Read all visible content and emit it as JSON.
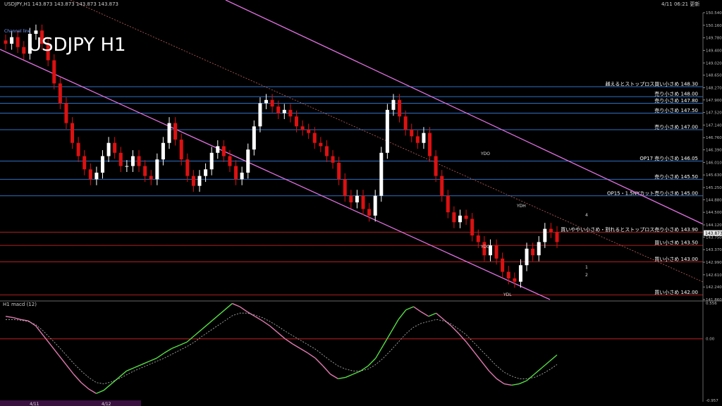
{
  "header": {
    "symbol_info": "USDJPY,H1  143.873 143.873 143.873 143.873",
    "datetime": "4/11 06:21 更新",
    "big_title": "USDJPY H1",
    "indicator_label": "Channel line",
    "sub_title": "H1  macd (12)"
  },
  "colors": {
    "background": "#000000",
    "bull": "#ffffff",
    "bear": "#dd1111",
    "channel": "#e070e0",
    "level_line": "#2f6fc0",
    "macd_up": "#55dd44",
    "macd_down": "#e07ab0",
    "price_marker": "#e8e8e8"
  },
  "chart_data": {
    "type": "candlestick",
    "symbol": "USDJPY",
    "timeframe": "H1",
    "ylim": [
      141.86,
      150.54
    ],
    "price_ticks": [
      "150.540",
      "150.160",
      "149.780",
      "149.400",
      "149.020",
      "148.650",
      "148.270",
      "147.900",
      "147.520",
      "147.140",
      "146.760",
      "146.390",
      "146.010",
      "145.630",
      "145.250",
      "144.880",
      "144.500",
      "144.120",
      "143.750",
      "143.370",
      "142.990",
      "142.610",
      "142.240",
      "141.860"
    ],
    "last_price": "143.873",
    "closes": [
      149.6,
      149.8,
      149.5,
      149.3,
      149.9,
      150.0,
      149.6,
      149.1,
      148.4,
      147.8,
      147.2,
      146.6,
      146.2,
      145.8,
      145.5,
      145.7,
      146.2,
      146.6,
      146.3,
      145.9,
      145.9,
      146.2,
      145.9,
      145.6,
      145.5,
      146.1,
      146.6,
      147.2,
      146.7,
      146.1,
      145.6,
      145.3,
      145.6,
      145.8,
      146.3,
      146.5,
      146.2,
      145.9,
      145.5,
      145.7,
      146.4,
      147.1,
      147.8,
      147.9,
      147.7,
      147.5,
      147.6,
      147.4,
      147.1,
      147.0,
      146.9,
      146.6,
      146.5,
      146.2,
      146.0,
      145.5,
      145.0,
      144.8,
      145.0,
      144.6,
      144.4,
      145.0,
      146.3,
      147.6,
      147.9,
      147.4,
      147.0,
      146.8,
      146.6,
      146.9,
      146.2,
      145.6,
      145.0,
      144.5,
      144.2,
      144.4,
      144.3,
      143.8,
      143.6,
      143.2,
      143.5,
      143.1,
      142.7,
      142.5,
      142.4,
      142.9,
      143.4,
      143.2,
      143.6,
      144.0,
      143.9,
      143.6
    ],
    "levels": [
      {
        "price": 148.3,
        "label": "越えるとストップロス買い小さめ 148.30"
      },
      {
        "price": 148.0,
        "label": "売り小さめ 148.00"
      },
      {
        "price": 147.8,
        "label": "売り小さめ 147.80"
      },
      {
        "price": 147.5,
        "label": "売り小さめ 147.50"
      },
      {
        "price": 147.0,
        "label": "売り小さめ 147.00"
      },
      {
        "price": 146.05,
        "label": "OP17 売り小さめ 146.05"
      },
      {
        "price": 145.5,
        "label": "売り小さめ 145.50"
      },
      {
        "price": 145.0,
        "label": "OP15・1.5NYカット売り小さめ 145.00"
      },
      {
        "price": 143.9,
        "label": "買いややい小さめ・割れるとストップロス売り小さめ 143.90"
      },
      {
        "price": 143.5,
        "label": "買い小さめ 143.50"
      },
      {
        "price": 143.0,
        "label": "買い小さめ 143.00"
      },
      {
        "price": 142.0,
        "label": "買い小さめ 142.00"
      }
    ],
    "marker_labels": [
      "YDO",
      "YDC",
      "YDH",
      "YDL",
      "1",
      "2",
      "4"
    ],
    "macd": {
      "title": "H1  macd (12)",
      "ylim": [
        -0.957,
        0.556
      ],
      "ticks": [
        "0.556",
        "0.00",
        "-0.957"
      ],
      "main": [
        0.35,
        0.33,
        0.3,
        0.28,
        0.2,
        0.05,
        -0.1,
        -0.25,
        -0.4,
        -0.55,
        -0.68,
        -0.78,
        -0.85,
        -0.8,
        -0.7,
        -0.6,
        -0.5,
        -0.45,
        -0.4,
        -0.35,
        -0.3,
        -0.22,
        -0.15,
        -0.1,
        -0.05,
        0.05,
        0.15,
        0.25,
        0.35,
        0.45,
        0.55,
        0.5,
        0.42,
        0.35,
        0.28,
        0.2,
        0.1,
        0.0,
        -0.08,
        -0.15,
        -0.22,
        -0.3,
        -0.42,
        -0.55,
        -0.62,
        -0.6,
        -0.55,
        -0.5,
        -0.42,
        -0.3,
        -0.1,
        0.1,
        0.3,
        0.45,
        0.5,
        0.42,
        0.35,
        0.4,
        0.3,
        0.2,
        0.08,
        -0.05,
        -0.2,
        -0.35,
        -0.5,
        -0.62,
        -0.7,
        -0.72,
        -0.7,
        -0.65,
        -0.55,
        -0.45,
        -0.35,
        -0.25
      ],
      "signal": [
        0.3,
        0.3,
        0.29,
        0.27,
        0.22,
        0.12,
        0.0,
        -0.12,
        -0.25,
        -0.38,
        -0.5,
        -0.6,
        -0.68,
        -0.7,
        -0.67,
        -0.62,
        -0.56,
        -0.5,
        -0.45,
        -0.4,
        -0.35,
        -0.3,
        -0.24,
        -0.18,
        -0.12,
        -0.05,
        0.04,
        0.12,
        0.2,
        0.28,
        0.36,
        0.4,
        0.4,
        0.37,
        0.33,
        0.27,
        0.2,
        0.12,
        0.05,
        -0.02,
        -0.09,
        -0.16,
        -0.25,
        -0.34,
        -0.42,
        -0.47,
        -0.5,
        -0.5,
        -0.47,
        -0.4,
        -0.3,
        -0.18,
        -0.05,
        0.08,
        0.18,
        0.24,
        0.27,
        0.3,
        0.28,
        0.23,
        0.15,
        0.06,
        -0.06,
        -0.18,
        -0.3,
        -0.42,
        -0.52,
        -0.58,
        -0.62,
        -0.62,
        -0.6,
        -0.55,
        -0.48,
        -0.4
      ]
    },
    "date_marks": [
      "4/11",
      "4/12"
    ]
  }
}
